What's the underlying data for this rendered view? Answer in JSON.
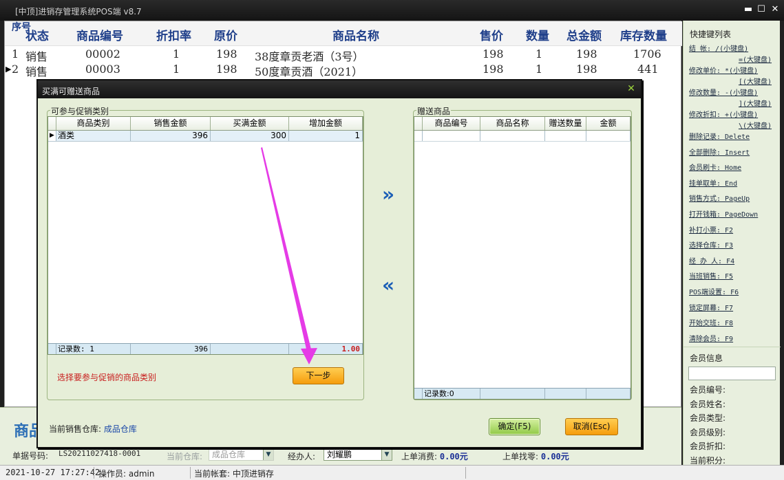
{
  "window": {
    "title": "[中顶]进销存管理系统POS端 v8.7",
    "minimize_glyph": "▬",
    "maximize_glyph": "☐",
    "close_glyph": "✕"
  },
  "sales_grid": {
    "headers": {
      "seq": "序号",
      "status": "状态",
      "code": "商品编号",
      "discount": "折扣率",
      "orig_price": "原价",
      "name": "商品名称",
      "price": "售价",
      "qty": "数量",
      "total": "总金额",
      "stock": "库存数量"
    },
    "rows": [
      {
        "seq": "1",
        "status": "销售",
        "code": "00002",
        "discount": "1",
        "orig_price": "198",
        "name": "38度章贡老酒（3号）",
        "price": "198",
        "qty": "1",
        "total": "198",
        "stock": "1706",
        "current": false
      },
      {
        "seq": "2",
        "status": "销售",
        "code": "00003",
        "discount": "1",
        "orig_price": "198",
        "name": "50度章贡酒（2021）",
        "price": "198",
        "qty": "1",
        "total": "198",
        "stock": "441",
        "current": true
      }
    ],
    "current_row_marker": "▶"
  },
  "bottom": {
    "big_title_partial": "商品",
    "doc_no_label": "单据号码:",
    "doc_no_value": "LS20211027418-0001",
    "warehouse_label": "当前仓库:",
    "warehouse_value": "成品仓库",
    "handler_label": "经办人:",
    "handler_value": "刘耀鹏",
    "last_spend_label": "上单消费:",
    "last_spend_value": "0.00元",
    "last_change_label": "上单找零:",
    "last_change_value": "0.00元",
    "dropdown_glyph": "▼"
  },
  "statusbar": {
    "datetime": "2021-10-27 17:27:42",
    "operator": "操作员: admin",
    "account": "当前帐套: 中顶进销存"
  },
  "shortcuts": {
    "title": "快捷键列表",
    "items": [
      {
        "label": "结    帐: /(小键盘)",
        "cont": "=(大键盘)"
      },
      {
        "label": "修改单价: *(小键盘)",
        "cont": "[(大键盘)"
      },
      {
        "label": "修改数量: -(小键盘)",
        "cont": "](大键盘)"
      },
      {
        "label": "修改折扣: +(小键盘)",
        "cont": "\\(大键盘)"
      },
      {
        "label": "删除记录: Delete"
      },
      {
        "label": "全部删除: Insert"
      },
      {
        "label": "会员刷卡: Home"
      },
      {
        "label": "挂单取单: End"
      },
      {
        "label": "销售方式: PageUp"
      },
      {
        "label": "打开钱箱: PageDown"
      },
      {
        "label": "补打小票: F2"
      },
      {
        "label": "选择仓库: F3"
      },
      {
        "label": "经 办 人: F4"
      },
      {
        "label": "当班销售: F5"
      },
      {
        "label": "POS端设置: F6"
      },
      {
        "label": "锁定屏幕: F7"
      },
      {
        "label": "开始交班: F8"
      },
      {
        "label": "清除会员: F9"
      }
    ]
  },
  "member": {
    "title": "会员信息",
    "input_value": "",
    "fields": [
      "会员编号:",
      "会员姓名:",
      "会员类型:",
      "会员级别:",
      "会员折扣:",
      "当前积分:"
    ]
  },
  "dialog": {
    "title": "买满可赠送商品",
    "close_glyph": "✕",
    "left_group": {
      "label": "可参与促销类别",
      "headers": [
        "商品类别",
        "销售金额",
        "买满金额",
        "增加金额"
      ],
      "rows": [
        {
          "category": "酒类",
          "sales_amount": "396",
          "threshold": "300",
          "add_amount": "1"
        }
      ],
      "footer": {
        "count": "记录数: 1",
        "sales_total": "396",
        "threshold_total": "",
        "add_total": "1.00"
      },
      "row_marker": "▶"
    },
    "hint": "选择要参与促销的商品类别",
    "next_button": "下一步",
    "add_arrow": "»",
    "remove_arrow": "«",
    "right_group": {
      "label": "赠送商品",
      "headers": [
        "商品编号",
        "商品名称",
        "赠送数量",
        "金额"
      ],
      "footer": {
        "count": "记录数:0"
      }
    },
    "warehouse_label": "当前销售仓库:",
    "warehouse_value": "成品仓库",
    "ok_button": "确定(F5)",
    "cancel_button": "取消(Esc)"
  },
  "colors": {
    "accent_blue": "#1f3f8a",
    "panel_green": "#e6eed8",
    "button_orange": "#f59d0c",
    "button_green": "#90c946",
    "hint_red": "#c81d1d",
    "pointer_magenta": "#e53be6"
  }
}
